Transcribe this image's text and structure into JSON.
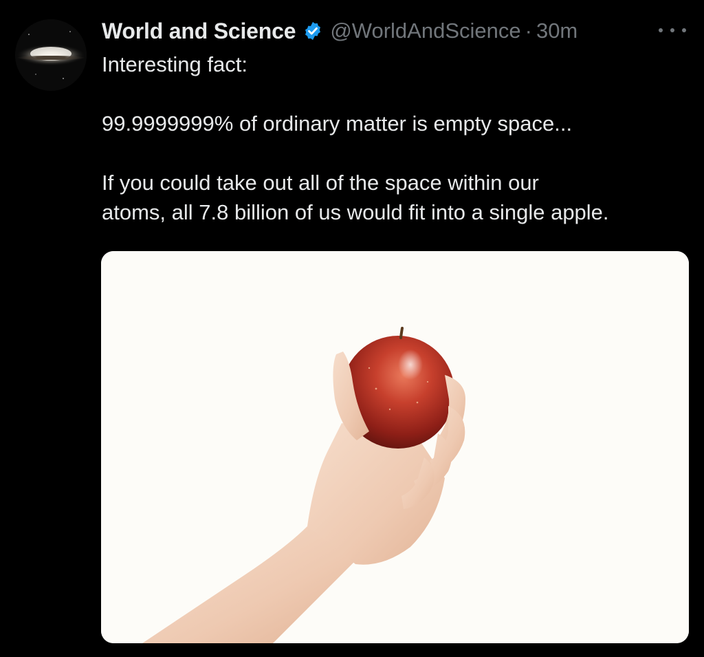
{
  "author": {
    "display_name": "World and Science",
    "verified": true,
    "handle": "@WorldAndScience",
    "separator": "·",
    "time": "30m",
    "avatar_icon": "galaxy-avatar"
  },
  "menu_icon": "more-options-icon",
  "tweet": {
    "line_1": "Interesting fact:",
    "line_2": "99.9999999% of ordinary matter is empty space...",
    "line_3": "If you could take out all of the space within our",
    "line_4": "atoms, all 7.8 billion of us would fit into a single apple."
  },
  "media": {
    "subject": "hand holding a red apple",
    "background_color": "#fdfcf8"
  },
  "colors": {
    "background": "#000000",
    "primary_text": "#e7e9ea",
    "secondary_text": "#71767b",
    "verified_blue": "#1d9bf0"
  }
}
